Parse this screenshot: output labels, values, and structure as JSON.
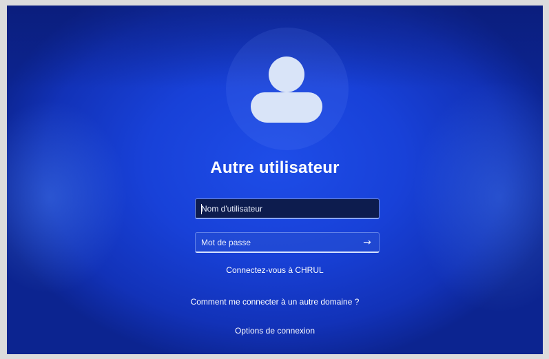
{
  "login": {
    "title": "Autre utilisateur",
    "username_placeholder": "Nom d'utilisateur",
    "username_value": "",
    "password_placeholder": "Mot de passe",
    "password_value": "",
    "submit_icon": "arrow-right-icon",
    "sign_in_to": "Connectez-vous à CHRUL",
    "other_domain": "Comment me connecter à un autre domaine ?",
    "sign_in_options": "Options de connexion"
  },
  "colors": {
    "background": "#1841d8",
    "text": "#ffffff",
    "avatar": "#d9e4f8"
  }
}
